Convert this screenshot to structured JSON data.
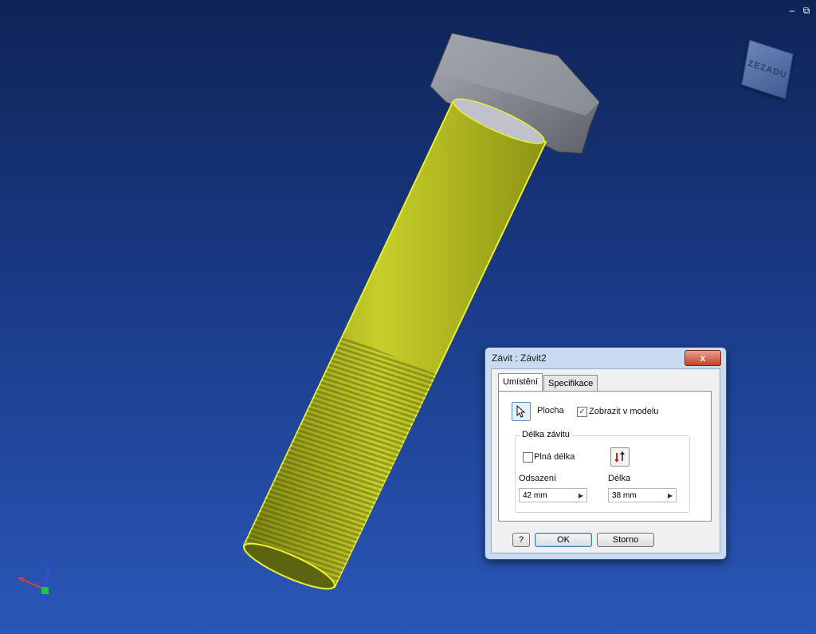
{
  "viewcube": {
    "label": "ZEZADU"
  },
  "window": {
    "minimize": "–",
    "restore": "⧉",
    "close": "✕"
  },
  "dialog": {
    "title": "Závit : Závit2",
    "close_label": "x",
    "tabs": [
      {
        "label": "Umístění",
        "active": true
      },
      {
        "label": "Specifikace",
        "active": false
      }
    ],
    "face_label": "Plocha",
    "show_in_model": {
      "label": "Zobrazit v modelu",
      "checked": true
    },
    "group_title": "Délka závitu",
    "full_length": {
      "label": "Plná délka",
      "checked": false
    },
    "offset": {
      "label": "Odsazení",
      "value": "42 mm"
    },
    "length": {
      "label": "Délka",
      "value": "38 mm"
    },
    "ok_label": "OK",
    "cancel_label": "Storno",
    "help_label": "?"
  },
  "colors": {
    "thread": "#b9c21c",
    "head": "#8a8e94",
    "background_top": "#0f2456",
    "background_bottom": "#2a57b8"
  }
}
